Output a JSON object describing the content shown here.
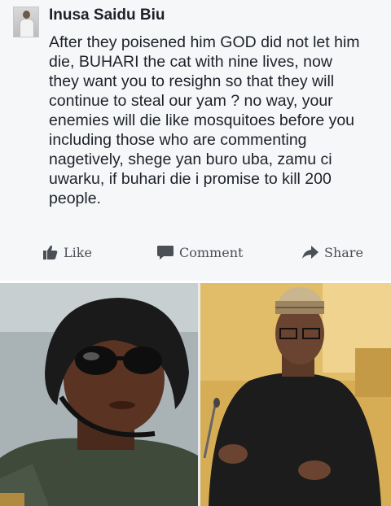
{
  "post": {
    "author": "Inusa Saidu Biu",
    "text": "After they poisened him GOD did not let him\ndie, BUHARI the cat with nine lives, now\nthey want you to resighn so that they will\ncontinue to steal our yam ? no way, your\nenemies will die like mosquitoes before you\nincluding those who are commenting\nnagetively, shege yan buro uba, zamu ci\nuwarku, if buhari die i promise to kill 200\npeople."
  },
  "actions": {
    "like": "Like",
    "comment": "Comment",
    "share": "Share"
  },
  "colors": {
    "text": "#1d2129",
    "action": "#4b4f56",
    "post_background": "#f6f7f9"
  },
  "icons": {
    "like": "thumbs-up-icon",
    "comment": "speech-bubble-icon",
    "share": "share-arrow-icon"
  }
}
